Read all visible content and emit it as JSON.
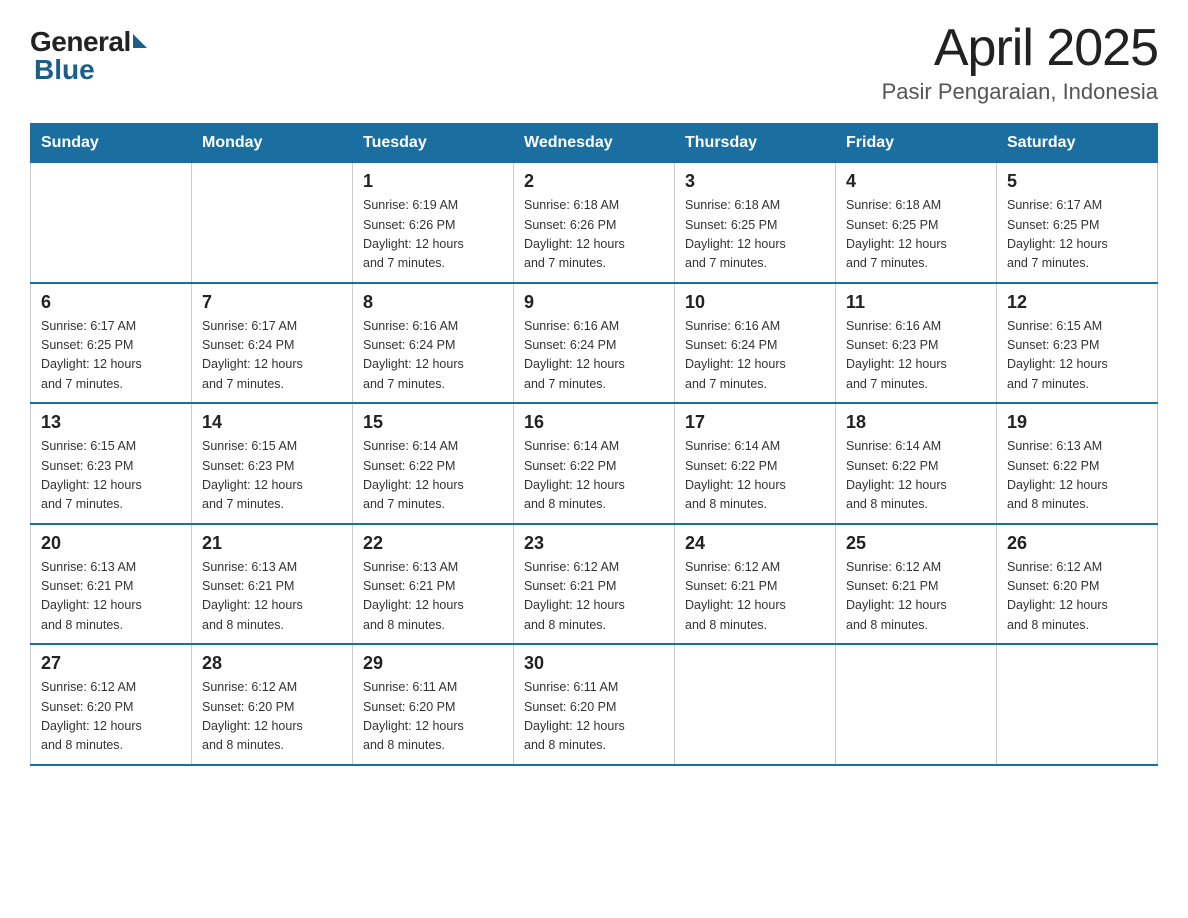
{
  "header": {
    "logo_general": "General",
    "logo_blue": "Blue",
    "title": "April 2025",
    "subtitle": "Pasir Pengaraian, Indonesia"
  },
  "weekdays": [
    "Sunday",
    "Monday",
    "Tuesday",
    "Wednesday",
    "Thursday",
    "Friday",
    "Saturday"
  ],
  "weeks": [
    [
      {
        "day": "",
        "info": ""
      },
      {
        "day": "",
        "info": ""
      },
      {
        "day": "1",
        "info": "Sunrise: 6:19 AM\nSunset: 6:26 PM\nDaylight: 12 hours\nand 7 minutes."
      },
      {
        "day": "2",
        "info": "Sunrise: 6:18 AM\nSunset: 6:26 PM\nDaylight: 12 hours\nand 7 minutes."
      },
      {
        "day": "3",
        "info": "Sunrise: 6:18 AM\nSunset: 6:25 PM\nDaylight: 12 hours\nand 7 minutes."
      },
      {
        "day": "4",
        "info": "Sunrise: 6:18 AM\nSunset: 6:25 PM\nDaylight: 12 hours\nand 7 minutes."
      },
      {
        "day": "5",
        "info": "Sunrise: 6:17 AM\nSunset: 6:25 PM\nDaylight: 12 hours\nand 7 minutes."
      }
    ],
    [
      {
        "day": "6",
        "info": "Sunrise: 6:17 AM\nSunset: 6:25 PM\nDaylight: 12 hours\nand 7 minutes."
      },
      {
        "day": "7",
        "info": "Sunrise: 6:17 AM\nSunset: 6:24 PM\nDaylight: 12 hours\nand 7 minutes."
      },
      {
        "day": "8",
        "info": "Sunrise: 6:16 AM\nSunset: 6:24 PM\nDaylight: 12 hours\nand 7 minutes."
      },
      {
        "day": "9",
        "info": "Sunrise: 6:16 AM\nSunset: 6:24 PM\nDaylight: 12 hours\nand 7 minutes."
      },
      {
        "day": "10",
        "info": "Sunrise: 6:16 AM\nSunset: 6:24 PM\nDaylight: 12 hours\nand 7 minutes."
      },
      {
        "day": "11",
        "info": "Sunrise: 6:16 AM\nSunset: 6:23 PM\nDaylight: 12 hours\nand 7 minutes."
      },
      {
        "day": "12",
        "info": "Sunrise: 6:15 AM\nSunset: 6:23 PM\nDaylight: 12 hours\nand 7 minutes."
      }
    ],
    [
      {
        "day": "13",
        "info": "Sunrise: 6:15 AM\nSunset: 6:23 PM\nDaylight: 12 hours\nand 7 minutes."
      },
      {
        "day": "14",
        "info": "Sunrise: 6:15 AM\nSunset: 6:23 PM\nDaylight: 12 hours\nand 7 minutes."
      },
      {
        "day": "15",
        "info": "Sunrise: 6:14 AM\nSunset: 6:22 PM\nDaylight: 12 hours\nand 7 minutes."
      },
      {
        "day": "16",
        "info": "Sunrise: 6:14 AM\nSunset: 6:22 PM\nDaylight: 12 hours\nand 8 minutes."
      },
      {
        "day": "17",
        "info": "Sunrise: 6:14 AM\nSunset: 6:22 PM\nDaylight: 12 hours\nand 8 minutes."
      },
      {
        "day": "18",
        "info": "Sunrise: 6:14 AM\nSunset: 6:22 PM\nDaylight: 12 hours\nand 8 minutes."
      },
      {
        "day": "19",
        "info": "Sunrise: 6:13 AM\nSunset: 6:22 PM\nDaylight: 12 hours\nand 8 minutes."
      }
    ],
    [
      {
        "day": "20",
        "info": "Sunrise: 6:13 AM\nSunset: 6:21 PM\nDaylight: 12 hours\nand 8 minutes."
      },
      {
        "day": "21",
        "info": "Sunrise: 6:13 AM\nSunset: 6:21 PM\nDaylight: 12 hours\nand 8 minutes."
      },
      {
        "day": "22",
        "info": "Sunrise: 6:13 AM\nSunset: 6:21 PM\nDaylight: 12 hours\nand 8 minutes."
      },
      {
        "day": "23",
        "info": "Sunrise: 6:12 AM\nSunset: 6:21 PM\nDaylight: 12 hours\nand 8 minutes."
      },
      {
        "day": "24",
        "info": "Sunrise: 6:12 AM\nSunset: 6:21 PM\nDaylight: 12 hours\nand 8 minutes."
      },
      {
        "day": "25",
        "info": "Sunrise: 6:12 AM\nSunset: 6:21 PM\nDaylight: 12 hours\nand 8 minutes."
      },
      {
        "day": "26",
        "info": "Sunrise: 6:12 AM\nSunset: 6:20 PM\nDaylight: 12 hours\nand 8 minutes."
      }
    ],
    [
      {
        "day": "27",
        "info": "Sunrise: 6:12 AM\nSunset: 6:20 PM\nDaylight: 12 hours\nand 8 minutes."
      },
      {
        "day": "28",
        "info": "Sunrise: 6:12 AM\nSunset: 6:20 PM\nDaylight: 12 hours\nand 8 minutes."
      },
      {
        "day": "29",
        "info": "Sunrise: 6:11 AM\nSunset: 6:20 PM\nDaylight: 12 hours\nand 8 minutes."
      },
      {
        "day": "30",
        "info": "Sunrise: 6:11 AM\nSunset: 6:20 PM\nDaylight: 12 hours\nand 8 minutes."
      },
      {
        "day": "",
        "info": ""
      },
      {
        "day": "",
        "info": ""
      },
      {
        "day": "",
        "info": ""
      }
    ]
  ]
}
